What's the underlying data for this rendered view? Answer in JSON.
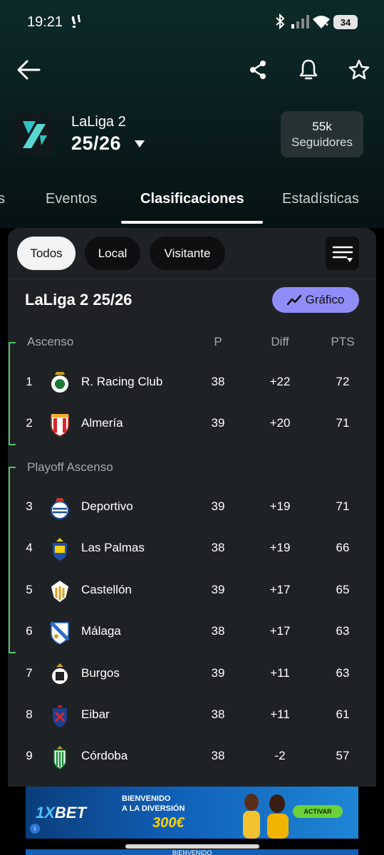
{
  "status_bar": {
    "time": "19:21",
    "battery": "34"
  },
  "league": {
    "name": "LaLiga 2",
    "season": "25/26"
  },
  "followers": {
    "count": "55k",
    "label": "Seguidores"
  },
  "tabs": [
    {
      "label": "s"
    },
    {
      "label": "Eventos"
    },
    {
      "label": "Clasificaciones"
    },
    {
      "label": "Estadísticas"
    }
  ],
  "filters": {
    "all": "Todos",
    "home": "Local",
    "away": "Visitante"
  },
  "table": {
    "title": "LaLiga 2 25/26",
    "chart_button": "Gráfico",
    "columns": {
      "played": "P",
      "diff": "Diff",
      "points": "PTS"
    },
    "groups": {
      "promotion": "Ascenso",
      "playoff": "Playoff Ascenso"
    },
    "rows": [
      {
        "pos": "1",
        "team": "R. Racing Club",
        "p": "38",
        "diff": "+22",
        "pts": "72"
      },
      {
        "pos": "2",
        "team": "Almería",
        "p": "39",
        "diff": "+20",
        "pts": "71"
      },
      {
        "pos": "3",
        "team": "Deportivo",
        "p": "39",
        "diff": "+19",
        "pts": "71"
      },
      {
        "pos": "4",
        "team": "Las Palmas",
        "p": "38",
        "diff": "+19",
        "pts": "66"
      },
      {
        "pos": "5",
        "team": "Castellón",
        "p": "39",
        "diff": "+17",
        "pts": "65"
      },
      {
        "pos": "6",
        "team": "Málaga",
        "p": "38",
        "diff": "+17",
        "pts": "63"
      },
      {
        "pos": "7",
        "team": "Burgos",
        "p": "39",
        "diff": "+11",
        "pts": "63"
      },
      {
        "pos": "8",
        "team": "Eibar",
        "p": "38",
        "diff": "+11",
        "pts": "61"
      },
      {
        "pos": "9",
        "team": "Córdoba",
        "p": "38",
        "diff": "-2",
        "pts": "57"
      }
    ]
  },
  "ad": {
    "brand_a": "1X",
    "brand_b": "BET",
    "line1": "BIENVENIDO",
    "line2": "A LA DIVERSIÓN",
    "amount": "300€",
    "cta": "ACTIVAR",
    "bottom_text": "BIENVENIDO"
  },
  "colors": {
    "accent": "#8f8df7",
    "promotion_bracket": "#58c15f",
    "card_bg": "#1f2225"
  }
}
